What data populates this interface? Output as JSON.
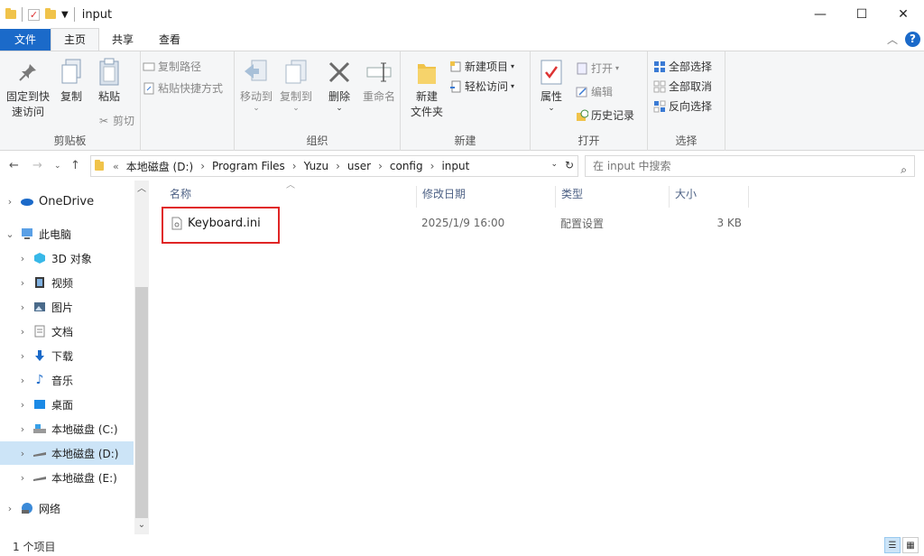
{
  "window": {
    "title": "input",
    "minimize": "—",
    "maximize": "☐",
    "close": "✕"
  },
  "tabs": {
    "file": "文件",
    "home": "主页",
    "share": "共享",
    "view": "查看"
  },
  "ribbon": {
    "clipboard": {
      "label": "剪贴板",
      "pin_line1": "固定到快",
      "pin_line2": "速访问",
      "copy": "复制",
      "paste": "粘贴",
      "copy_path": "复制路径",
      "paste_shortcut": "粘贴快捷方式",
      "cut": "剪切"
    },
    "organize": {
      "label": "组织",
      "move_to": "移动到",
      "copy_to": "复制到",
      "delete": "删除",
      "rename": "重命名"
    },
    "new": {
      "label": "新建",
      "new_folder_line1": "新建",
      "new_folder_line2": "文件夹",
      "new_item": "新建项目",
      "easy_access": "轻松访问"
    },
    "open": {
      "label": "打开",
      "properties": "属性",
      "open": "打开",
      "edit": "编辑",
      "history": "历史记录"
    },
    "select": {
      "label": "选择",
      "select_all": "全部选择",
      "select_none": "全部取消",
      "invert": "反向选择"
    }
  },
  "address": {
    "crumbs": [
      "本地磁盘 (D:)",
      "Program Files",
      "Yuzu",
      "user",
      "config",
      "input"
    ],
    "search_placeholder": "在 input 中搜索"
  },
  "nav": {
    "items": [
      "OneDrive",
      "此电脑",
      "3D 对象",
      "视频",
      "图片",
      "文档",
      "下载",
      "音乐",
      "桌面",
      "本地磁盘 (C:)",
      "本地磁盘 (D:)",
      "本地磁盘 (E:)",
      "网络"
    ]
  },
  "columns": {
    "name": "名称",
    "modified": "修改日期",
    "type": "类型",
    "size": "大小"
  },
  "files": [
    {
      "name": "Keyboard.ini",
      "modified": "2025/1/9 16:00",
      "type": "配置设置",
      "size": "3 KB"
    }
  ],
  "status": {
    "count": "1 个项目"
  },
  "colors": {
    "accent": "#1b6ac9",
    "selected": "#cce4f7",
    "highlight": "#e02525"
  }
}
